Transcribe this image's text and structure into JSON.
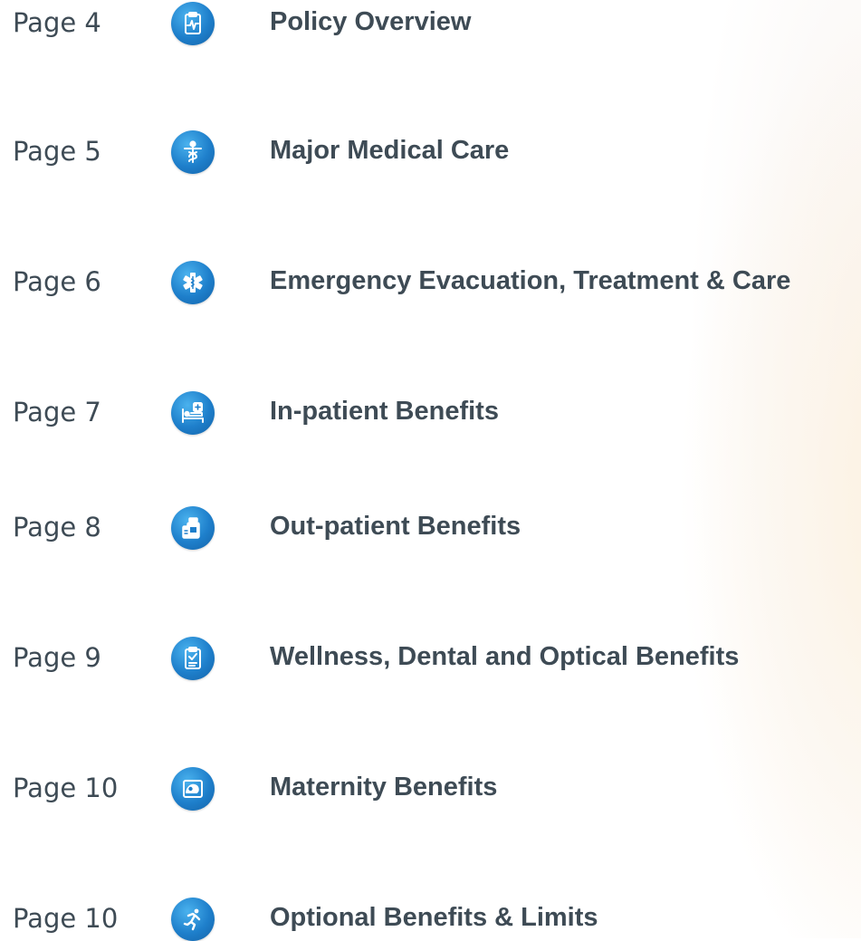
{
  "toc": {
    "entries": [
      {
        "page": "Page 4",
        "title": "Policy Overview",
        "icon": "clipboard-heartbeat-icon"
      },
      {
        "page": "Page 5",
        "title": "Major Medical Care",
        "icon": "caduceus-person-icon"
      },
      {
        "page": "Page 6",
        "title": "Emergency Evacuation, Treatment & Care",
        "icon": "star-of-life-icon"
      },
      {
        "page": "Page 7",
        "title": "In-patient Benefits",
        "icon": "hospital-bed-icon"
      },
      {
        "page": "Page 8",
        "title": "Out-patient Benefits",
        "icon": "medicine-bottles-icon"
      },
      {
        "page": "Page 9",
        "title": "Wellness, Dental and Optical Benefits",
        "icon": "clipboard-check-icon"
      },
      {
        "page": "Page 10",
        "title": "Maternity Benefits",
        "icon": "ultrasound-baby-icon"
      },
      {
        "page": "Page 10",
        "title": "Optional Benefits & Limits",
        "icon": "running-person-icon"
      }
    ]
  },
  "colors": {
    "text": "#3e4b55",
    "icon_blue": "#1e7fcb",
    "icon_glyph": "#ffffff",
    "background_glow": "#fdf1de"
  }
}
